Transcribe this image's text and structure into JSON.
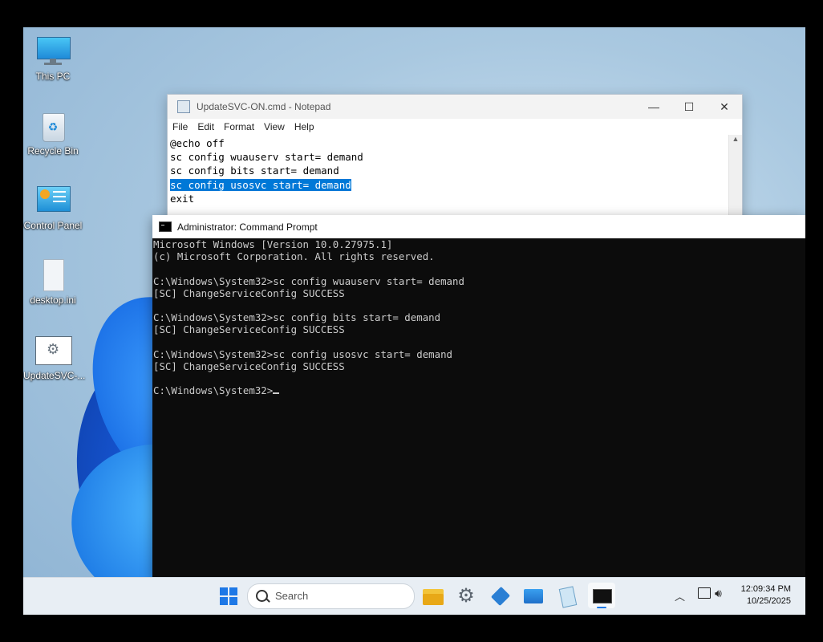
{
  "desktop": {
    "icons": [
      {
        "label": "This PC",
        "icon": "monitor-icon"
      },
      {
        "label": "Recycle Bin",
        "icon": "recycle-bin-icon"
      },
      {
        "label": "Control Panel",
        "icon": "control-panel-icon"
      },
      {
        "label": "desktop.ini",
        "icon": "file-icon"
      },
      {
        "label": "UpdateSVC-...",
        "icon": "cmd-file-icon"
      }
    ]
  },
  "notepad": {
    "title": "UpdateSVC-ON.cmd - Notepad",
    "menu": [
      "File",
      "Edit",
      "Format",
      "View",
      "Help"
    ],
    "lines": [
      "@echo off",
      "sc config wuauserv start= demand",
      "sc config bits start= demand",
      "sc config usosvc start= demand",
      "exit"
    ],
    "selected_line_index": 3
  },
  "cmd": {
    "title": "Administrator: Command Prompt",
    "lines": [
      "Microsoft Windows [Version 10.0.27975.1]",
      "(c) Microsoft Corporation. All rights reserved.",
      "",
      "C:\\Windows\\System32>sc config wuauserv start= demand",
      "[SC] ChangeServiceConfig SUCCESS",
      "",
      "C:\\Windows\\System32>sc config bits start= demand",
      "[SC] ChangeServiceConfig SUCCESS",
      "",
      "C:\\Windows\\System32>sc config usosvc start= demand",
      "[SC] ChangeServiceConfig SUCCESS",
      ""
    ],
    "prompt": "C:\\Windows\\System32>"
  },
  "taskbar": {
    "search_placeholder": "Search",
    "apps": [
      "start-icon",
      "file-explorer-icon",
      "settings-icon",
      "sandbox-icon",
      "photos-icon",
      "notepad-icon",
      "terminal-icon"
    ],
    "time": "12:09:34 PM",
    "date": "10/25/2025"
  },
  "colors": {
    "accent": "#0078d7",
    "cmd_bg": "#0c0c0c",
    "cmd_fg": "#cccccc"
  }
}
